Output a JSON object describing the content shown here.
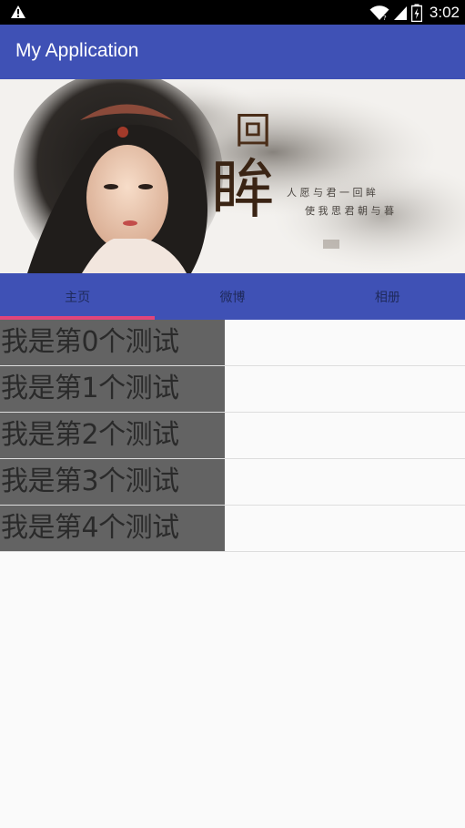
{
  "status_bar": {
    "time": "3:02",
    "icons": [
      "warning-icon",
      "wifi-icon",
      "signal-icon",
      "battery-icon"
    ]
  },
  "app_bar": {
    "title": "My Application",
    "color": "#3f51b5"
  },
  "banner": {
    "calligraphy_char": "眸",
    "calligraphy_top": "回",
    "poem_line1": "人 愿 与 君 一 回 眸",
    "poem_line2": "使 我 思 君 朝 与 暮"
  },
  "tabs": [
    {
      "label": "主页",
      "selected": true
    },
    {
      "label": "微博",
      "selected": false
    },
    {
      "label": "相册",
      "selected": false
    }
  ],
  "tab_indicator_color": "#e0457b",
  "list": [
    {
      "label": "我是第0个测试"
    },
    {
      "label": "我是第1个测试"
    },
    {
      "label": "我是第2个测试"
    },
    {
      "label": "我是第3个测试"
    },
    {
      "label": "我是第4个测试"
    }
  ]
}
